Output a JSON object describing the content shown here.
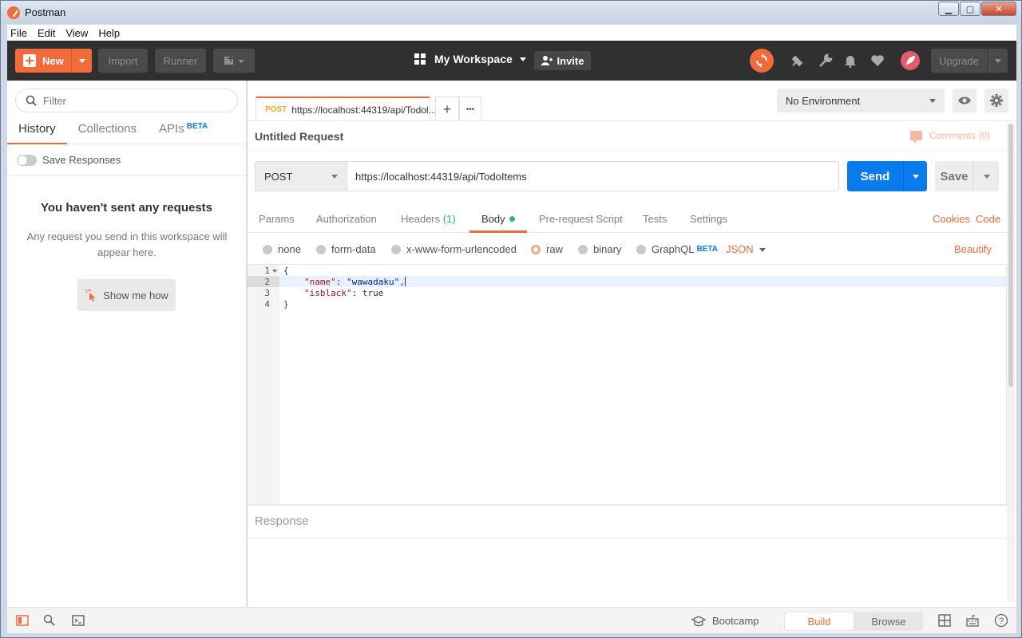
{
  "window": {
    "title": "Postman",
    "minimize": "▁",
    "maximize": "▢",
    "close": "✕"
  },
  "menu": [
    "File",
    "Edit",
    "View",
    "Help"
  ],
  "header": {
    "new_label": "New",
    "import_label": "Import",
    "runner_label": "Runner",
    "workspace_label": "My Workspace",
    "invite_label": "Invite",
    "upgrade_label": "Upgrade"
  },
  "sidebar": {
    "filter_placeholder": "Filter",
    "tabs": [
      {
        "label": "History",
        "active": true
      },
      {
        "label": "Collections",
        "active": false
      },
      {
        "label": "APIs",
        "badge": "BETA",
        "active": false
      }
    ],
    "save_responses_label": "Save Responses",
    "empty_title": "You haven't sent any requests",
    "empty_text": "Any request you send in this workspace will appear here.",
    "show_me_how": "Show me how"
  },
  "request_tab": {
    "method": "POST",
    "url_short": "https://localhost:44319/api/Todol...",
    "add_label": "+",
    "more_label": "•••"
  },
  "environment": {
    "selected": "No Environment"
  },
  "request": {
    "name": "Untitled Request",
    "comments_label": "Comments (0)",
    "method": "POST",
    "url": "https://localhost:44319/api/TodoItems",
    "send_label": "Send",
    "save_label": "Save"
  },
  "subtabs": {
    "params": "Params",
    "authorization": "Authorization",
    "headers": "Headers",
    "headers_count": "(1)",
    "body": "Body",
    "prerequest": "Pre-request Script",
    "tests": "Tests",
    "settings": "Settings",
    "cookies": "Cookies",
    "code": "Code"
  },
  "body_modes": {
    "none": "none",
    "form_data": "form-data",
    "urlencoded": "x-www-form-urlencoded",
    "raw": "raw",
    "binary": "binary",
    "graphql": "GraphQL",
    "graphql_badge": "BETA",
    "format": "JSON",
    "beautify": "Beautify"
  },
  "editor": {
    "line_numbers": [
      "1",
      "2",
      "3",
      "4"
    ],
    "lines": {
      "l1": "{",
      "l2_key": "\"name\"",
      "l2_sep": ": ",
      "l2_val": "\"wawadaku\"",
      "l2_end": ",",
      "l3_key": "\"isblack\"",
      "l3_sep": ": ",
      "l3_val": "true",
      "l4": "}"
    }
  },
  "response": {
    "label": "Response"
  },
  "footer": {
    "bootcamp_label": "Bootcamp",
    "build_label": "Build",
    "browse_label": "Browse",
    "help_label": "?"
  },
  "colors": {
    "accent": "#f26b3a",
    "send_blue": "#097bed",
    "success_green": "#26b47f"
  }
}
